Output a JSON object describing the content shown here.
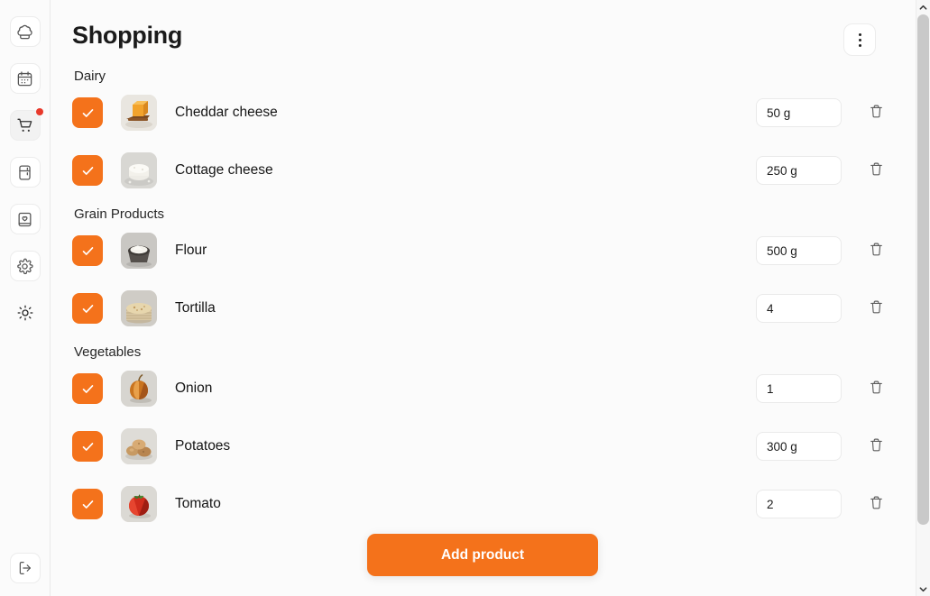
{
  "sidebar": {
    "items": [
      {
        "name": "chef-hat",
        "label": "Recipes",
        "active": false,
        "badge": false
      },
      {
        "name": "calendar",
        "label": "Meal plan",
        "active": false,
        "badge": false
      },
      {
        "name": "shopping-cart",
        "label": "Shopping",
        "active": true,
        "badge": true
      },
      {
        "name": "fridge",
        "label": "Fridge",
        "active": false,
        "badge": false
      },
      {
        "name": "cookbook-heart",
        "label": "Favorites",
        "active": false,
        "badge": false
      },
      {
        "name": "gear",
        "label": "Settings",
        "active": false,
        "badge": false
      },
      {
        "name": "sun",
        "label": "Theme",
        "active": false,
        "badge": false
      }
    ],
    "logout": {
      "name": "logout",
      "label": "Log out"
    }
  },
  "header": {
    "title": "Shopping",
    "menu_icon": "kebab-menu-icon"
  },
  "categories": [
    {
      "title": "Dairy",
      "items": [
        {
          "name": "Cheddar cheese",
          "quantity": "50 g",
          "checked": true,
          "thumb": "cheddar-cheese"
        },
        {
          "name": "Cottage cheese",
          "quantity": "250 g",
          "checked": true,
          "thumb": "cottage-cheese"
        }
      ]
    },
    {
      "title": "Grain Products",
      "items": [
        {
          "name": "Flour",
          "quantity": "500 g",
          "checked": true,
          "thumb": "flour-bowl"
        },
        {
          "name": "Tortilla",
          "quantity": "4",
          "checked": true,
          "thumb": "tortilla-stack"
        }
      ]
    },
    {
      "title": "Vegetables",
      "items": [
        {
          "name": "Onion",
          "quantity": "1",
          "checked": true,
          "thumb": "onion"
        },
        {
          "name": "Potatoes",
          "quantity": "300 g",
          "checked": true,
          "thumb": "potatoes"
        },
        {
          "name": "Tomato",
          "quantity": "2",
          "checked": true,
          "thumb": "tomato"
        }
      ]
    }
  ],
  "fab": {
    "label": "Add product"
  },
  "colors": {
    "accent": "#f4721b",
    "badge": "#e8392b",
    "background": "#fbfbfb",
    "text": "#151515",
    "border": "#eaeaea"
  },
  "scrollbar": {
    "up_icon": "chevron-up-icon",
    "down_icon": "chevron-down-icon"
  }
}
